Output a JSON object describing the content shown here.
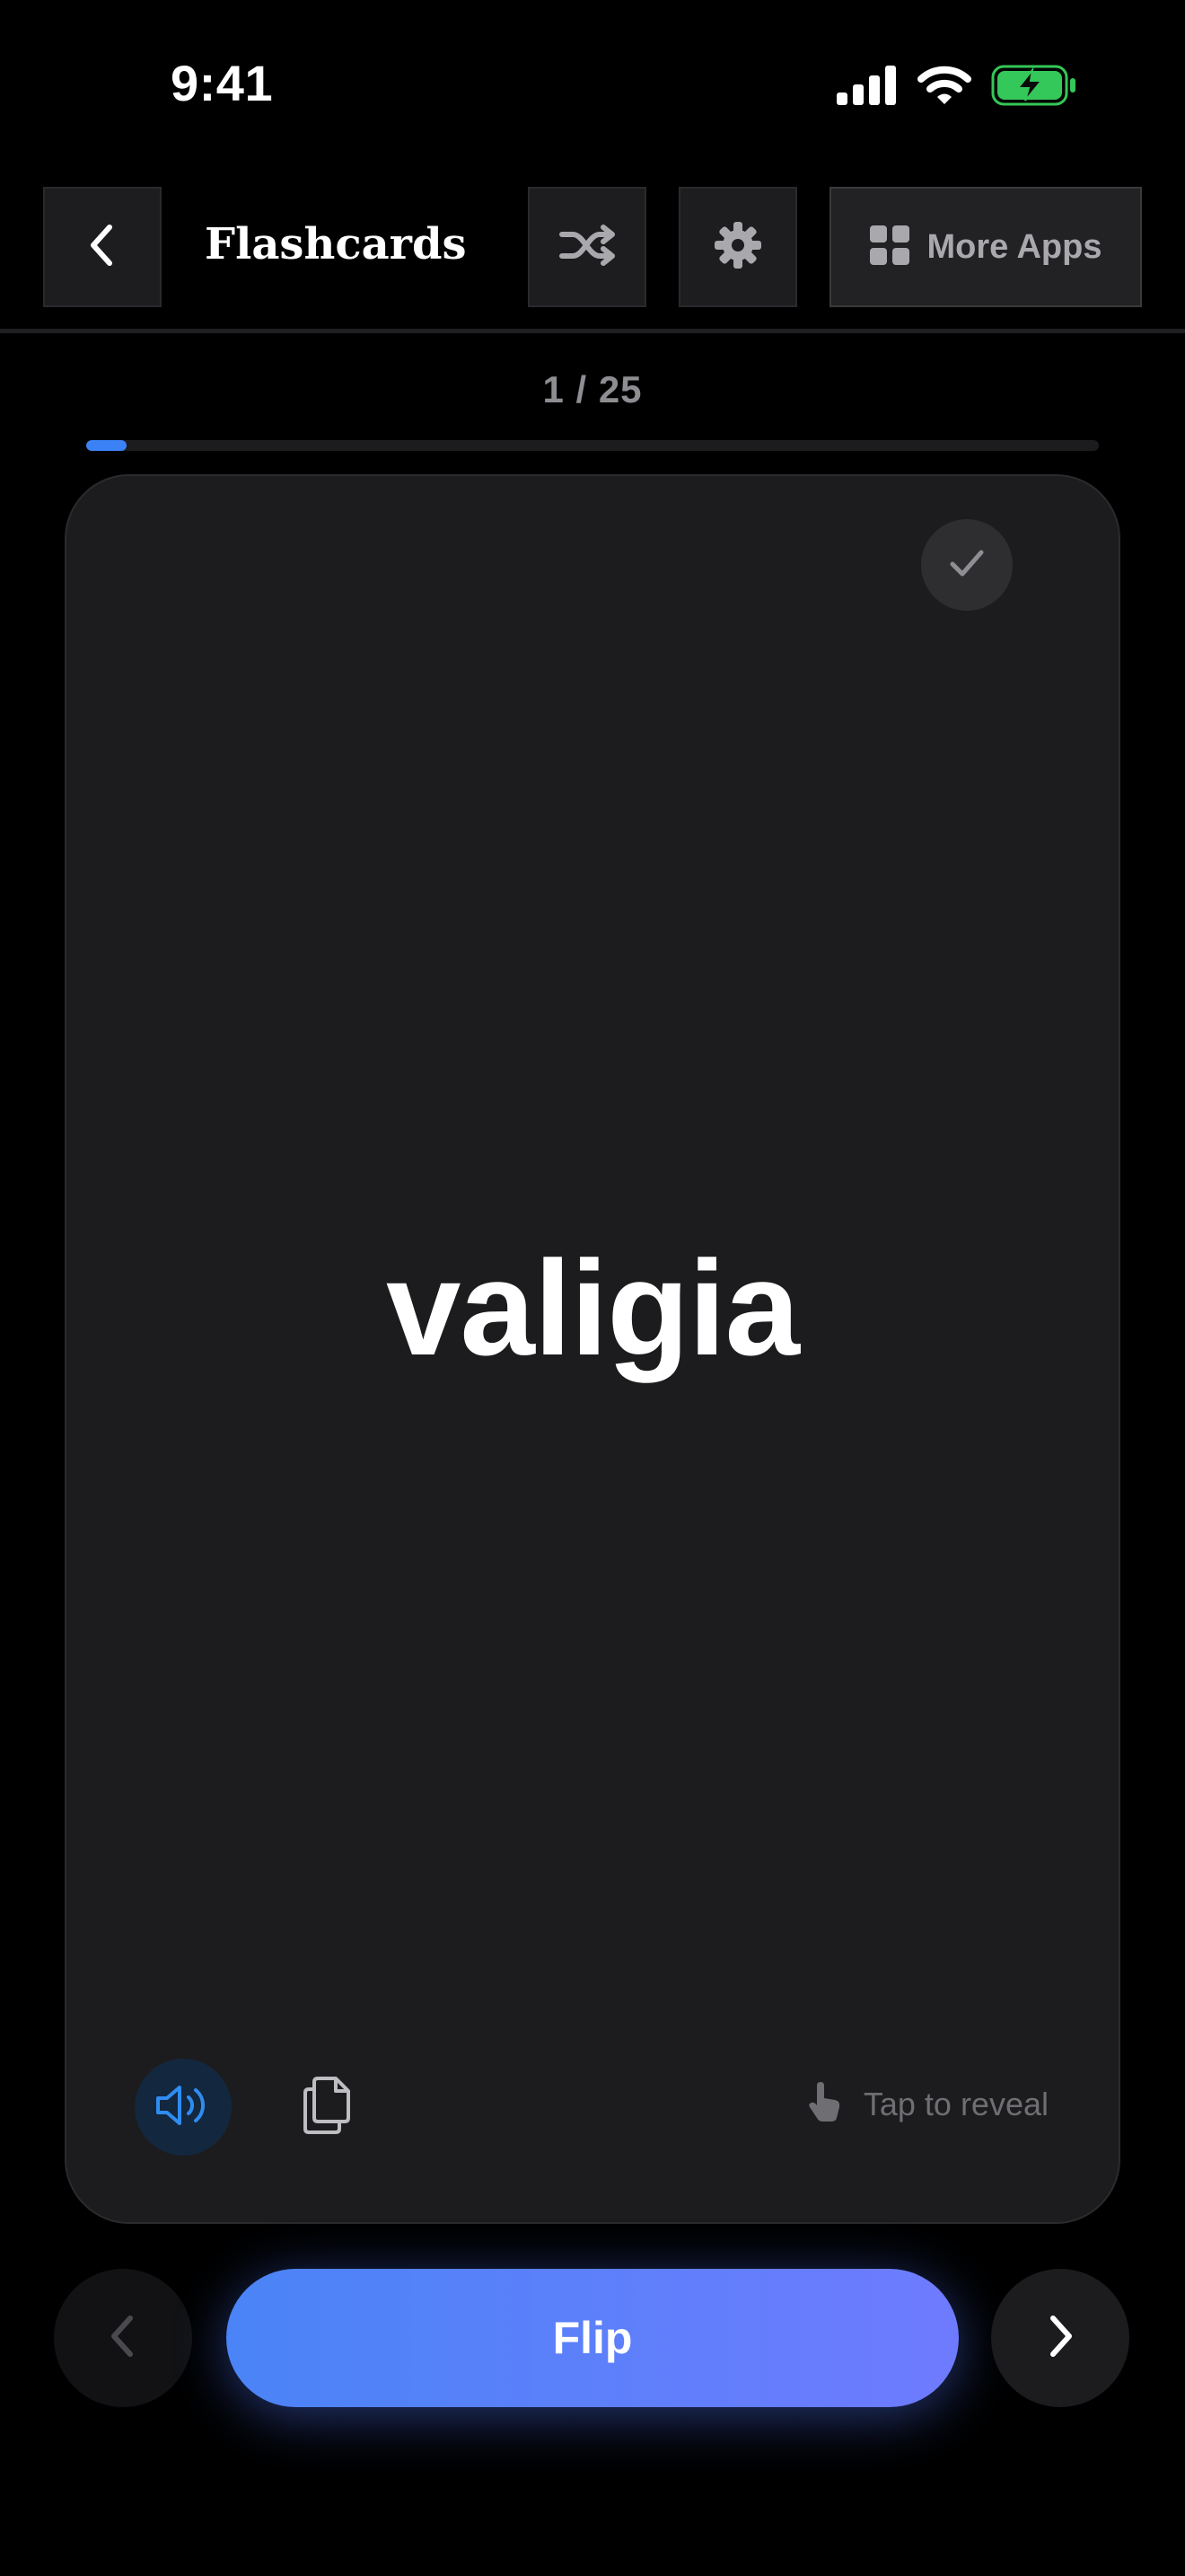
{
  "status_bar": {
    "time": "9:41",
    "icons": [
      "cellular-signal-icon",
      "wifi-icon",
      "battery-charging-icon"
    ],
    "battery_color": "#34c759"
  },
  "header": {
    "back_icon": "chevron-left-icon",
    "title": "Flashcards",
    "shuffle_icon": "shuffle-icon",
    "settings_icon": "gear-icon",
    "more_apps_icon": "grid-icon",
    "more_apps_label": "More Apps"
  },
  "progress": {
    "current": 1,
    "total": 25,
    "label": "1 / 25",
    "fraction": 0.04,
    "color": "#3b82f6"
  },
  "card": {
    "word": "valigia",
    "known_icon": "checkmark-icon",
    "speak_icon": "speaker-icon",
    "copy_icon": "copy-icon",
    "hint_icon": "tap-hand-icon",
    "hint_label": "Tap to reveal"
  },
  "controls": {
    "prev_icon": "chevron-left-icon",
    "flip_label": "Flip",
    "next_icon": "chevron-right-icon",
    "accent_gradient": [
      "#4a84f6",
      "#6f7bff"
    ]
  }
}
